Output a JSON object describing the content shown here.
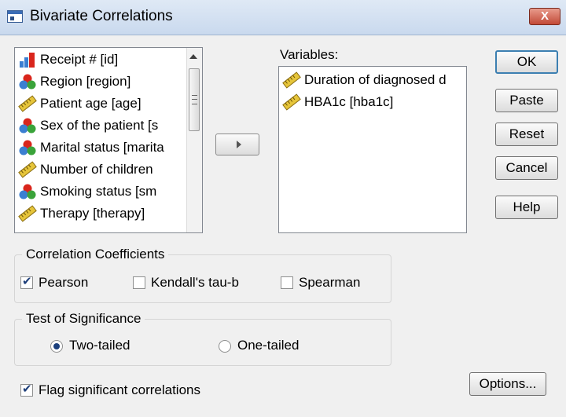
{
  "window": {
    "title": "Bivariate Correlations",
    "close_glyph": "X"
  },
  "variables_list": {
    "items": [
      {
        "label": "Receipt # [id]",
        "icon": "ordinal-bar-chart-icon"
      },
      {
        "label": "Region [region]",
        "icon": "nominal-balls-icon"
      },
      {
        "label": "Patient age [age]",
        "icon": "scale-ruler-icon"
      },
      {
        "label": "Sex of the patient [s",
        "icon": "nominal-balls-icon"
      },
      {
        "label": "Marital status [marita",
        "icon": "nominal-balls-icon"
      },
      {
        "label": "Number of children",
        "icon": "scale-ruler-icon"
      },
      {
        "label": "Smoking status [sm",
        "icon": "nominal-balls-icon"
      },
      {
        "label": "Therapy [therapy]",
        "icon": "scale-ruler-icon"
      }
    ]
  },
  "selected": {
    "label": "Variables:",
    "items": [
      {
        "label": "Duration of diagnosed d",
        "icon": "scale-ruler-icon"
      },
      {
        "label": "HBA1c [hba1c]",
        "icon": "scale-ruler-icon"
      }
    ]
  },
  "buttons": {
    "ok": "OK",
    "paste": "Paste",
    "reset": "Reset",
    "cancel": "Cancel",
    "help": "Help",
    "options": "Options..."
  },
  "correlation": {
    "title": "Correlation Coefficients",
    "pearson": {
      "label": "Pearson",
      "checked": true
    },
    "kendall": {
      "label": "Kendall's tau-b",
      "checked": false
    },
    "spearman": {
      "label": "Spearman",
      "checked": false
    }
  },
  "significance": {
    "title": "Test of Significance",
    "two_tailed": {
      "label": "Two-tailed",
      "selected": true
    },
    "one_tailed": {
      "label": "One-tailed",
      "selected": false
    }
  },
  "flag": {
    "label": "Flag significant correlations",
    "checked": true
  },
  "colors": {
    "title_bar": "#c9d9ee",
    "close": "#c24a37",
    "default_border": "#3c7fb1"
  }
}
